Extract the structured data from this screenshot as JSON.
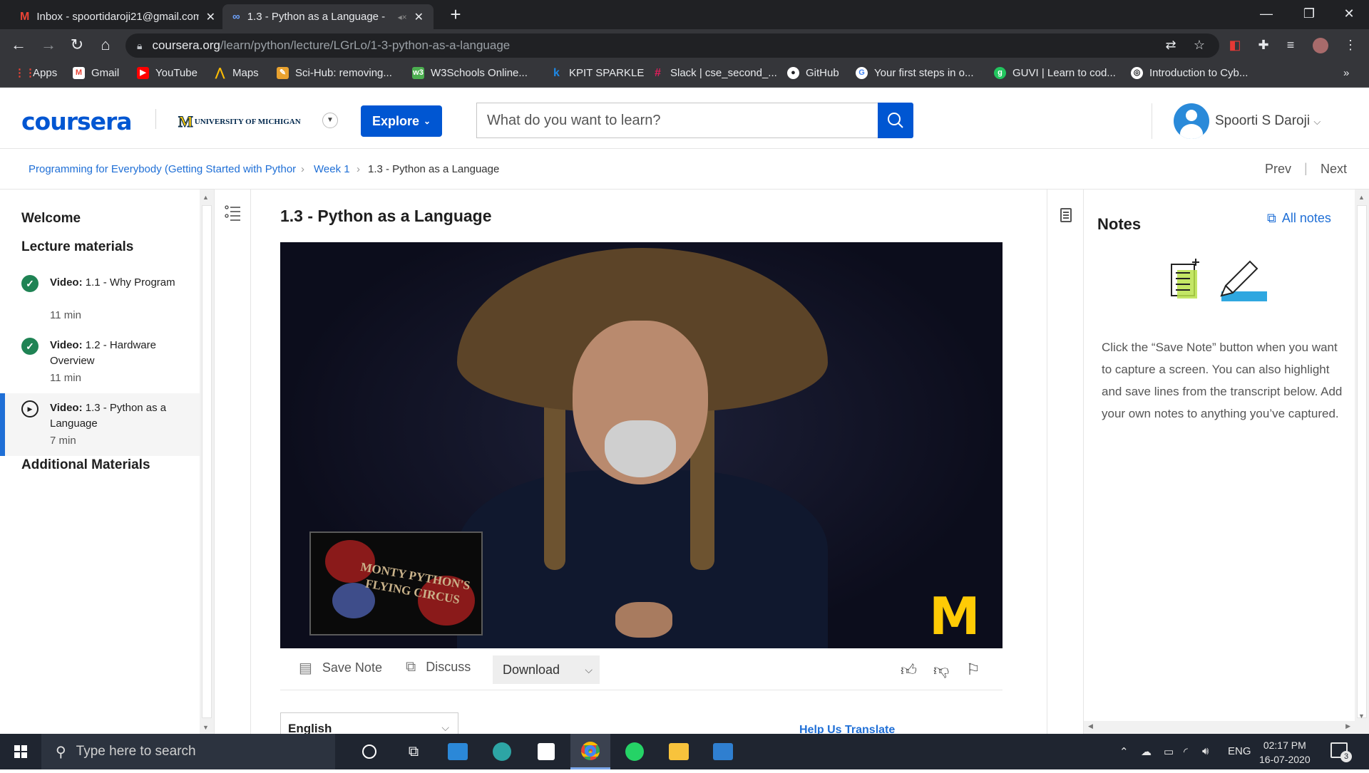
{
  "browser": {
    "tabs": [
      {
        "title": "Inbox - spoortidaroji21@gmail.com",
        "icon": "gmail-icon"
      },
      {
        "title": "1.3 - Python as a Language - ",
        "icon": "coursera-icon"
      }
    ],
    "url_host": "coursera.org",
    "url_path": "/learn/python/lecture/LGrLo/1-3-python-as-a-language",
    "bookmarks": [
      {
        "label": "Apps",
        "icon": "apps-grid-icon",
        "color": "#ea4335"
      },
      {
        "label": "Gmail",
        "icon": "gmail-icon",
        "color": "#ea4335"
      },
      {
        "label": "YouTube",
        "icon": "youtube-icon",
        "color": "#ff0000"
      },
      {
        "label": "Maps",
        "icon": "maps-icon",
        "color": "#fbbc04"
      },
      {
        "label": "Sci-Hub: removing...",
        "icon": "scihub-icon",
        "color": "#e9a22f"
      },
      {
        "label": "W3Schools Online...",
        "icon": "w3schools-icon",
        "color": "#4caf50"
      },
      {
        "label": "KPIT SPARKLE",
        "icon": "kpit-icon",
        "color": "#1e88e5"
      },
      {
        "label": "Slack | cse_second_...",
        "icon": "slack-icon",
        "color": "#e01e5a"
      },
      {
        "label": "GitHub",
        "icon": "github-icon",
        "color": "#ffffff"
      },
      {
        "label": "Your first steps in o...",
        "icon": "google-icon",
        "color": "#4285f4"
      },
      {
        "label": "GUVI | Learn to cod...",
        "icon": "guvi-icon",
        "color": "#22c55e"
      },
      {
        "label": "Introduction to Cyb...",
        "icon": "globe-icon",
        "color": "#ffffff"
      }
    ],
    "more_bookmarks": "»"
  },
  "header": {
    "logo": "coursera",
    "university": "UNIVERSITY OF MICHIGAN",
    "explore_label": "Explore",
    "search_placeholder": "What do you want to learn?",
    "user_name": "Spoorti S Daroji"
  },
  "breadcrumb": {
    "course": "Programming for Everybody (Getting Started with Pythor",
    "week": "Week 1",
    "current": "1.3 - Python as a Language",
    "prev": "Prev",
    "next": "Next"
  },
  "sidebar": {
    "welcome": "Welcome",
    "lecture_materials": "Lecture materials",
    "items": [
      {
        "type": "Video:",
        "title": "1.1 - Why Program",
        "duration": "11 min",
        "status": "completed"
      },
      {
        "type": "Video:",
        "title": "1.2 - Hardware Overview",
        "duration": "11 min",
        "status": "completed"
      },
      {
        "type": "Video:",
        "title": "1.3 - Python as a Language",
        "duration": "7 min",
        "status": "current"
      }
    ],
    "additional": "Additional Materials"
  },
  "main": {
    "title": "1.3 - Python as a Language",
    "video_overlay_text": "MONTY PYTHON'S FLYING CIRCUS",
    "video_logo": "M",
    "save_note": "Save Note",
    "discuss": "Discuss",
    "download": "Download",
    "language": "English",
    "help_translate": "Help Us Translate"
  },
  "notes": {
    "title": "Notes",
    "all_notes": "All notes",
    "description": "Click the “Save Note” button when you want to capture a screen. You can also highlight and save lines from the transcript below. Add your own notes to anything you’ve captured."
  },
  "taskbar": {
    "search_placeholder": "Type here to search",
    "language": "ENG",
    "time": "02:17 PM",
    "date": "16-07-2020",
    "notifications": "3"
  },
  "colors": {
    "coursera_blue": "#0056d2",
    "link_blue": "#1f6fd6",
    "complete_green": "#1f8354",
    "michigan_maize": "#ffcb05"
  }
}
